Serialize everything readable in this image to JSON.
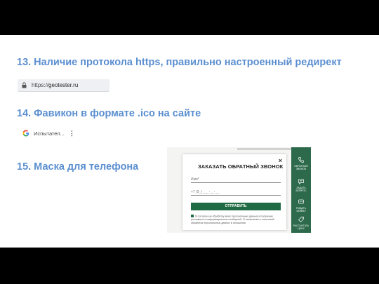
{
  "headings": {
    "h13": "13. Наличие протокола https, правильно настроенный редирект",
    "h14": "14. Фавикон в формате .ico на сайте",
    "h15": "15. Маска для телефона"
  },
  "browser": {
    "url_scheme": "https://",
    "url_host": "geotester.ru",
    "tab_title": "Испытател...",
    "tab_menu": "⋮"
  },
  "callback_form": {
    "title": "ЗАКАЗАТЬ ОБРАТНЫЙ ЗВОНОК",
    "close": "×",
    "name_placeholder": "Имя*",
    "phone_mask": "+7 (9_) ___-__-__",
    "submit_label": "ОТПРАВИТЬ",
    "consent_text": "Я согласен на обработку моих персональных данных и получение рекламных и информационных сообщений. Я ознакомлен с политикой обработки персональных данных в отношении"
  },
  "sidebar": {
    "items": [
      {
        "label": "ОБРАТНЫЙ ЗВОНОК",
        "icon": "phone-icon"
      },
      {
        "label": "ЗАДАТЬ ВОПРОС",
        "icon": "chat-icon"
      },
      {
        "label": "ПОДАТЬ ЗАЯВКУ",
        "icon": "message-icon"
      },
      {
        "label": "РАССЧИТАТЬ ЦЕНУ",
        "icon": "tag-icon"
      }
    ]
  },
  "colors": {
    "heading": "#5b8fd0",
    "brand_green": "#1f6b44",
    "sidebar_green": "#2c6a4b"
  }
}
